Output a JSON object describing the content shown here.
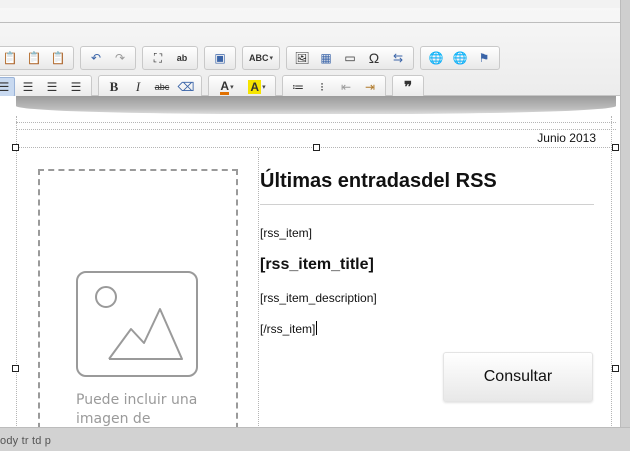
{
  "toolbar": {
    "row1": [
      {
        "name": "paste-icon",
        "glyph": "📋",
        "cls": "ic-clip"
      },
      {
        "name": "paste-text-icon",
        "glyph": "📋",
        "cls": "ic-clip"
      },
      {
        "name": "paste-word-icon",
        "glyph": "📋",
        "cls": "ic-clip"
      },
      {
        "sep": true
      },
      {
        "name": "undo-icon",
        "glyph": "↶",
        "cls": "ic-blue"
      },
      {
        "name": "redo-icon",
        "glyph": "↷",
        "cls": "ic-gray"
      },
      {
        "sep": true
      },
      {
        "name": "find-icon",
        "glyph": "⛶",
        "cls": ""
      },
      {
        "name": "replace-icon",
        "glyph": "ab",
        "cls": "ic-abc"
      },
      {
        "sep": true
      },
      {
        "name": "select-all-icon",
        "glyph": "▣",
        "cls": "ic-blue"
      },
      {
        "sep": true
      },
      {
        "name": "spellcheck-icon",
        "glyph": "ABC",
        "cls": "ic-abc",
        "dropdown": true,
        "wide": true
      },
      {
        "sep": true
      },
      {
        "name": "image-icon",
        "glyph": "🖼",
        "cls": ""
      },
      {
        "name": "table-icon",
        "glyph": "▦",
        "cls": "ic-blue"
      },
      {
        "name": "horizontal-rule-icon",
        "glyph": "▭",
        "cls": ""
      },
      {
        "name": "special-char-icon",
        "glyph": "Ω",
        "cls": "ic-omega"
      },
      {
        "name": "page-break-icon",
        "glyph": "⇆",
        "cls": "ic-blue"
      },
      {
        "sep": true
      },
      {
        "name": "link-icon",
        "glyph": "🌐",
        "cls": "ic-green"
      },
      {
        "name": "unlink-icon",
        "glyph": "🌐",
        "cls": "ic-gray"
      },
      {
        "name": "anchor-flag-icon",
        "glyph": "⚑",
        "cls": "ic-blue"
      }
    ],
    "row2": [
      {
        "name": "align-left-icon",
        "glyph": "☰",
        "cls": "",
        "active": true
      },
      {
        "name": "align-center-icon",
        "glyph": "☰",
        "cls": ""
      },
      {
        "name": "align-right-icon",
        "glyph": "☰",
        "cls": ""
      },
      {
        "name": "align-justify-icon",
        "glyph": "☰",
        "cls": ""
      },
      {
        "sep": true
      },
      {
        "name": "bold-icon",
        "glyph": "B",
        "cls": "ic-bold"
      },
      {
        "name": "italic-icon",
        "glyph": "I",
        "cls": "ic-ital"
      },
      {
        "name": "strikethrough-icon",
        "glyph": "abc",
        "cls": "ic-strike"
      },
      {
        "name": "eraser-icon",
        "glyph": "⌫",
        "cls": "ic-blue"
      },
      {
        "sep": true
      },
      {
        "name": "text-color-icon",
        "glyph": "A",
        "cls": "ic-fg",
        "dropdown": true,
        "wide": true
      },
      {
        "name": "background-color-icon",
        "glyph": "A",
        "cls": "ic-bg",
        "dropdown": true,
        "wide": true
      },
      {
        "sep": true
      },
      {
        "name": "numbered-list-icon",
        "glyph": "≔",
        "cls": ""
      },
      {
        "name": "bulleted-list-icon",
        "glyph": "⁝",
        "cls": ""
      },
      {
        "name": "outdent-icon",
        "glyph": "⇤",
        "cls": "ic-gray"
      },
      {
        "name": "indent-icon",
        "glyph": "⇥",
        "cls": "ic-clip"
      },
      {
        "sep": true
      },
      {
        "name": "blockquote-icon",
        "glyph": "❞",
        "cls": "ic-quote"
      }
    ]
  },
  "content": {
    "date": "Junio 2013",
    "image_placeholder": "Puede incluir una imagen de",
    "heading": "Últimas entradasdel RSS",
    "rss_open": "[rss_item]",
    "rss_title": "[rss_item_title]",
    "rss_description": "[rss_item_description]",
    "rss_close": "[/rss_item]",
    "button_label": "Consultar"
  },
  "status": {
    "path": "ody  tr  td  p"
  }
}
